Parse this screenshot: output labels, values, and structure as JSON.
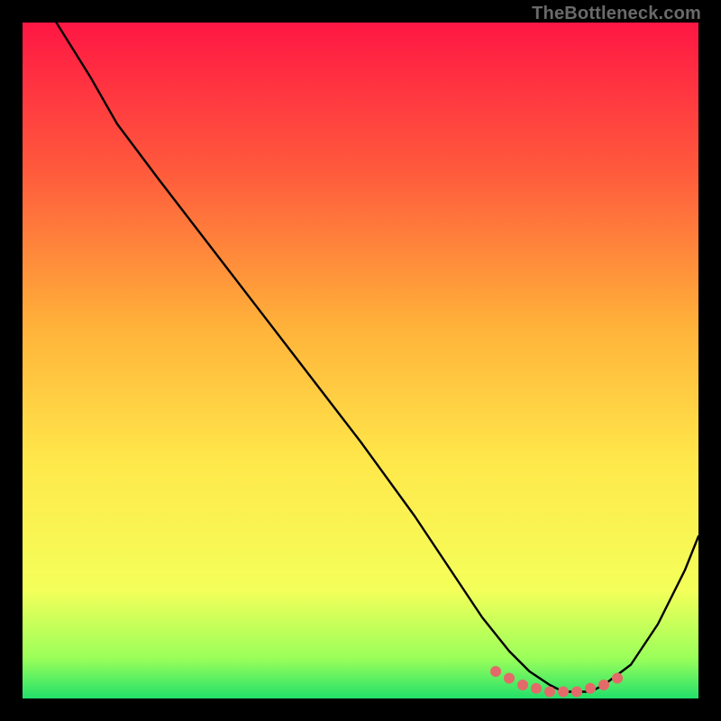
{
  "watermark": "TheBottleneck.com",
  "colors": {
    "bg_black": "#000000",
    "grad_top": "#ff1744",
    "grad_upper_mid": "#ff5a3c",
    "grad_mid": "#ffb23a",
    "grad_lower_mid": "#ffe84a",
    "grad_lower": "#f4ff5a",
    "grad_green1": "#9bff5a",
    "grad_green2": "#22e06a",
    "curve": "#000000",
    "markers": "#e46a6a",
    "watermark": "#6a6a6a"
  },
  "chart_data": {
    "type": "line",
    "title": "",
    "xlabel": "",
    "ylabel": "",
    "xlim": [
      0,
      100
    ],
    "ylim": [
      0,
      100
    ],
    "notes": "Background is a vertical gradient from red (top, high mismatch) through orange/yellow to green (bottom, optimal). Black curve shows bottleneck percentage vs. an implicit x-axis (component performance). Pink dots mark the near-zero-bottleneck optimal region.",
    "series": [
      {
        "name": "bottleneck_curve",
        "x": [
          5,
          10,
          14,
          20,
          30,
          40,
          50,
          58,
          64,
          68,
          72,
          75,
          78,
          80,
          82,
          84,
          86,
          90,
          94,
          98,
          100
        ],
        "y": [
          100,
          92,
          85,
          77,
          64,
          51,
          38,
          27,
          18,
          12,
          7,
          4,
          2,
          1,
          1,
          1,
          2,
          5,
          11,
          19,
          24
        ]
      },
      {
        "name": "optimal_points",
        "x": [
          70,
          72,
          74,
          76,
          78,
          80,
          82,
          84,
          86,
          88
        ],
        "y": [
          4,
          3,
          2,
          1.5,
          1,
          1,
          1,
          1.5,
          2,
          3
        ]
      }
    ]
  }
}
